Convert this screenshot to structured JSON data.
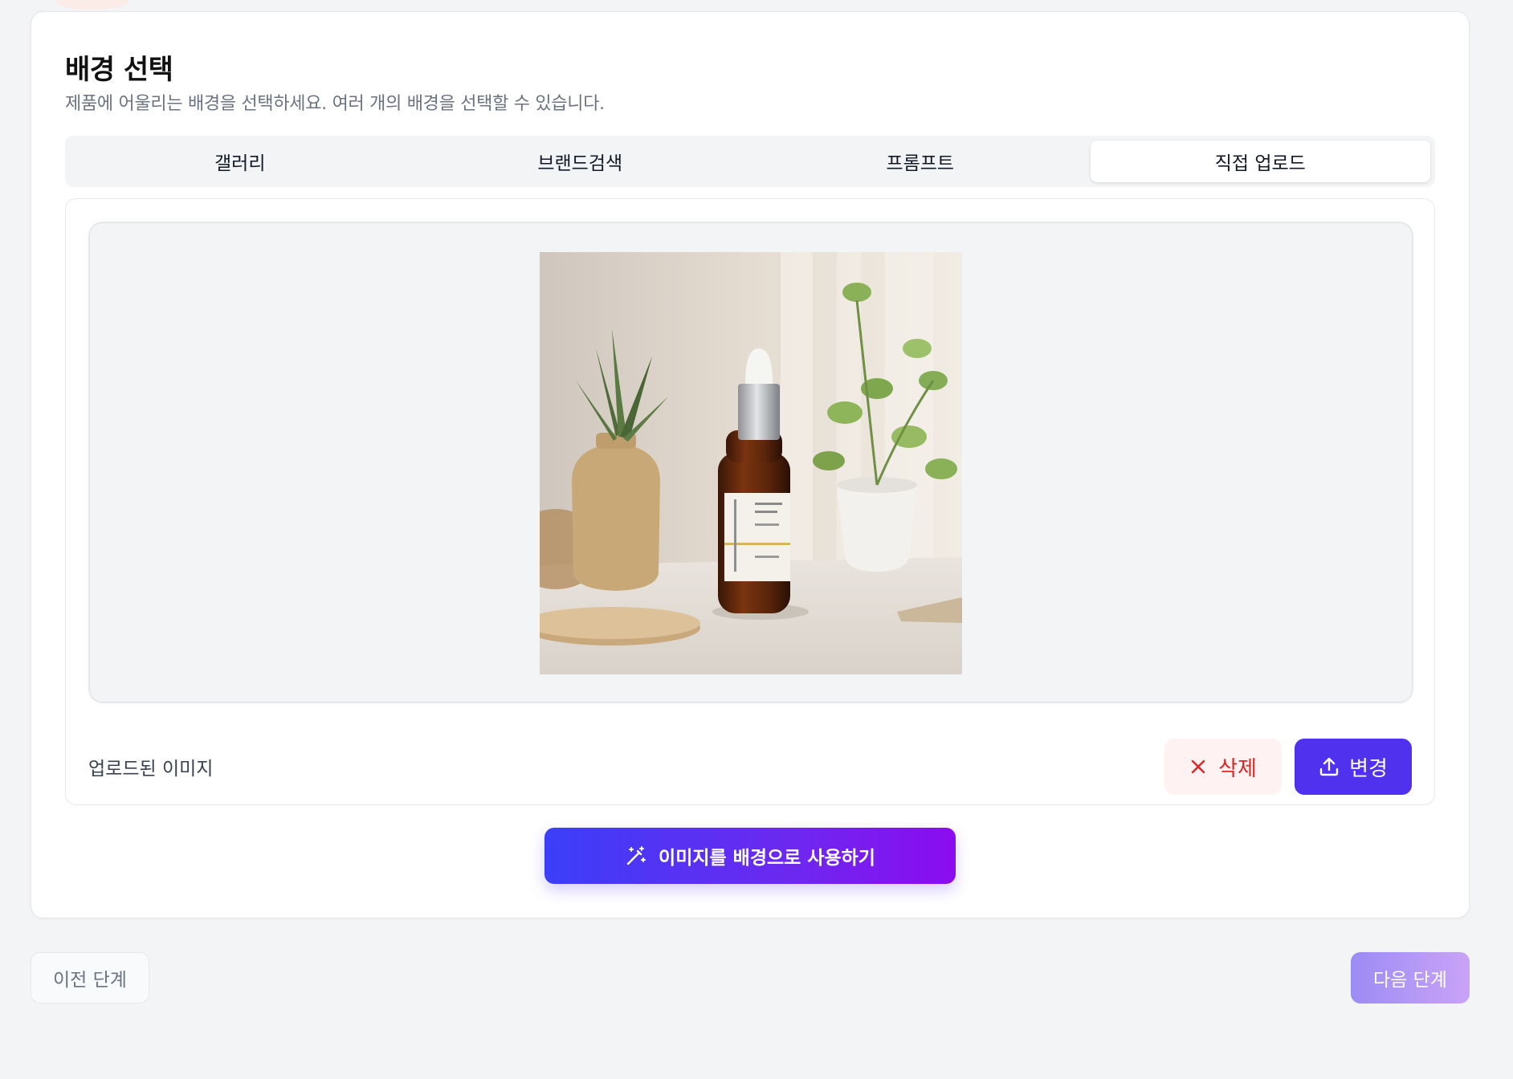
{
  "section": {
    "title": "배경 선택",
    "subtitle": "제품에 어울리는 배경을 선택하세요. 여러 개의 배경을 선택할 수 있습니다."
  },
  "tabs": [
    {
      "label": "갤러리",
      "active": false
    },
    {
      "label": "브랜드검색",
      "active": false
    },
    {
      "label": "프롬프트",
      "active": false
    },
    {
      "label": "직접 업로드",
      "active": true
    }
  ],
  "upload": {
    "uploaded_label": "업로드된 이미지",
    "delete_label": "삭제",
    "change_label": "변경",
    "preview_icon": "product-photo-serum-bottle"
  },
  "actions": {
    "use_as_background": "이미지를 배경으로 사용하기",
    "prev_step": "이전 단계",
    "next_step": "다음 단계"
  },
  "colors": {
    "primary": "#4f31ee",
    "danger": "#dc2626",
    "danger_bg": "#fef2f2",
    "gradient_start": "#3b3ef8",
    "gradient_end": "#8b0cf0"
  }
}
